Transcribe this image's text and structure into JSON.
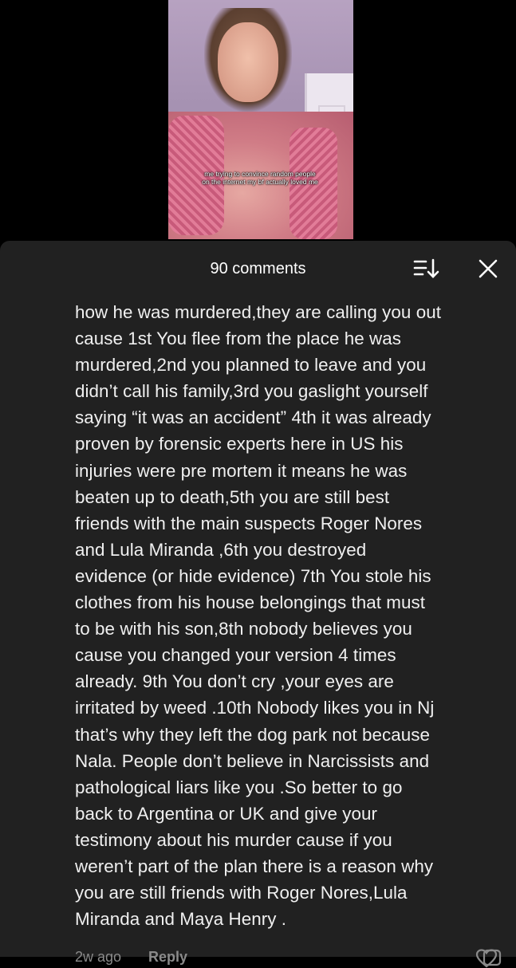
{
  "video": {
    "caption": "me trying to convince random people on the internet my bf actually loved me"
  },
  "comments_sheet": {
    "count_label": "90 comments",
    "sort_icon": "sort-icon",
    "close_icon": "close-icon"
  },
  "comment": {
    "text": "how he was murdered,they are calling you out\ncause 1st You flee from the place he was\nmurdered,2nd you planned to leave and you\ndidn’t call his family,3rd you gaslight yourself\nsaying “it was an accident” 4th it was already\nproven by forensic experts here in US his\ninjuries were pre mortem it means he was\nbeaten up to death,5th you are still best\nfriends with the main suspects Roger Nores\nand Lula Miranda ,6th you destroyed\nevidence (or hide evidence) 7th You stole his\nclothes from his house belongings that must\nto be with his son,8th nobody believes you\ncause you changed your version 4 times\nalready. 9th You don’t cry ,your eyes are\nirritated by weed .10th Nobody likes you in Nj\nthat’s why they left the dog park not because\nNala. People don’t believe in Narcissists and\npathological liars like you .So better to go\nback to Argentina or UK and give your\ntestimony about his murder cause if you\nweren’t part of the plan there is a reason why\nyou are still friends with Roger Nores,Lula\nMiranda and Maya Henry .",
    "time": "2w ago",
    "reply_label": "Reply"
  },
  "colors": {
    "sheet_background": "#212121",
    "text": "#f0f0f0",
    "muted": "#8a8a8a"
  }
}
